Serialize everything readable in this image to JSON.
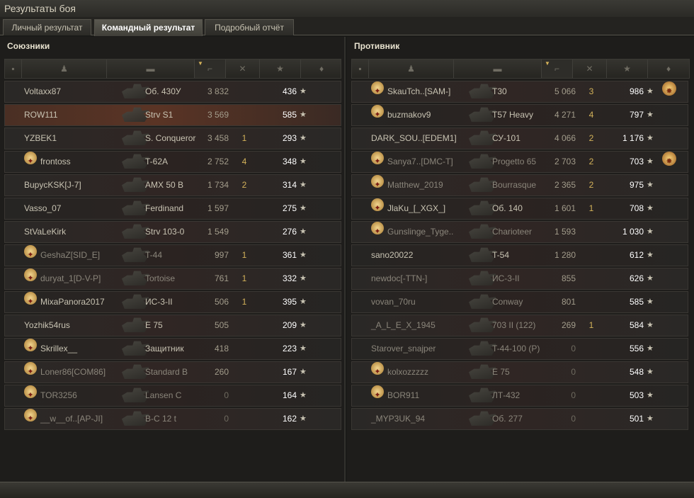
{
  "window": {
    "title": "Результаты боя"
  },
  "tabs": [
    {
      "label": "Личный результат",
      "active": false
    },
    {
      "label": "Командный результат",
      "active": true
    },
    {
      "label": "Подробный отчёт",
      "active": false
    }
  ],
  "columns": {
    "icons": [
      "badge-icon",
      "player-icon",
      "tank-icon",
      "damage-icon",
      "kills-icon",
      "xp-star-icon",
      "medal-icon"
    ]
  },
  "allies": {
    "title": "Союзники",
    "rows": [
      {
        "player": "Voltaxx87",
        "tank": "Об. 430У",
        "damage": "3 832",
        "kills": "",
        "xp": "436",
        "badge": false,
        "medal": false,
        "state": "alive"
      },
      {
        "player": "ROW111",
        "tank": "Strv S1",
        "damage": "3 569",
        "kills": "",
        "xp": "585",
        "badge": false,
        "medal": false,
        "state": "self"
      },
      {
        "player": "YZBEK1",
        "tank": "S. Conqueror",
        "damage": "3 458",
        "kills": "1",
        "xp": "293",
        "badge": false,
        "medal": false,
        "state": "alive"
      },
      {
        "player": "frontoss",
        "tank": "T-62A",
        "damage": "2 752",
        "kills": "4",
        "xp": "348",
        "badge": true,
        "medal": false,
        "state": "alive"
      },
      {
        "player": "BupycKSK[J-7]",
        "tank": "AMX 50 B",
        "damage": "1 734",
        "kills": "2",
        "xp": "314",
        "badge": false,
        "medal": false,
        "state": "alive"
      },
      {
        "player": "Vasso_07",
        "tank": "Ferdinand",
        "damage": "1 597",
        "kills": "",
        "xp": "275",
        "badge": false,
        "medal": false,
        "state": "alive"
      },
      {
        "player": "StVaLeKirk",
        "tank": "Strv 103-0",
        "damage": "1 549",
        "kills": "",
        "xp": "276",
        "badge": false,
        "medal": false,
        "state": "alive"
      },
      {
        "player": "GeshaZ[SID_E]",
        "tank": "T-44",
        "damage": "997",
        "kills": "1",
        "xp": "361",
        "badge": true,
        "medal": false,
        "state": "dead"
      },
      {
        "player": "duryat_1[D-V-P]",
        "tank": "Tortoise",
        "damage": "761",
        "kills": "1",
        "xp": "332",
        "badge": true,
        "medal": false,
        "state": "dead"
      },
      {
        "player": "MixaPanora2017",
        "tank": "ИС-3-II",
        "damage": "506",
        "kills": "1",
        "xp": "395",
        "badge": true,
        "medal": false,
        "state": "alive"
      },
      {
        "player": "Yozhik54rus",
        "tank": "E 75",
        "damage": "505",
        "kills": "",
        "xp": "209",
        "badge": false,
        "medal": false,
        "state": "alive"
      },
      {
        "player": "Skrillex__",
        "tank": "Защитник",
        "damage": "418",
        "kills": "",
        "xp": "223",
        "badge": true,
        "medal": false,
        "state": "alive"
      },
      {
        "player": "Loner86[COM86]",
        "tank": "Standard B",
        "damage": "260",
        "kills": "",
        "xp": "167",
        "badge": true,
        "medal": false,
        "state": "dead"
      },
      {
        "player": "TOR3256",
        "tank": "Lansen C",
        "damage": "0",
        "kills": "",
        "xp": "164",
        "badge": true,
        "medal": false,
        "state": "dead"
      },
      {
        "player": "__w__of..[AP-JI]",
        "tank": "B-C 12 t",
        "damage": "0",
        "kills": "",
        "xp": "162",
        "badge": true,
        "medal": false,
        "state": "dead"
      }
    ]
  },
  "enemies": {
    "title": "Противник",
    "rows": [
      {
        "player": "SkauTch..[SAM-]",
        "tank": "T30",
        "damage": "5 066",
        "kills": "3",
        "xp": "986",
        "badge": true,
        "medal": true,
        "state": "alive"
      },
      {
        "player": "buzmakov9",
        "tank": "T57 Heavy",
        "damage": "4 271",
        "kills": "4",
        "xp": "797",
        "badge": true,
        "medal": false,
        "state": "alive"
      },
      {
        "player": "DARK_SOU..[EDEM1]",
        "tank": "СУ-101",
        "damage": "4 066",
        "kills": "2",
        "xp": "1 176",
        "badge": false,
        "medal": false,
        "state": "alive"
      },
      {
        "player": "Sanya7..[DMC-T]",
        "tank": "Progetto 65",
        "damage": "2 703",
        "kills": "2",
        "xp": "703",
        "badge": true,
        "medal": true,
        "state": "dead"
      },
      {
        "player": "Matthew_2019",
        "tank": "Bourrasque",
        "damage": "2 365",
        "kills": "2",
        "xp": "975",
        "badge": true,
        "medal": false,
        "state": "dead"
      },
      {
        "player": "JlaKu_[_XGX_]",
        "tank": "Об. 140",
        "damage": "1 601",
        "kills": "1",
        "xp": "708",
        "badge": true,
        "medal": false,
        "state": "alive"
      },
      {
        "player": "Gunslinge_Tyge..",
        "tank": "Charioteer",
        "damage": "1 593",
        "kills": "",
        "xp": "1 030",
        "badge": true,
        "medal": false,
        "state": "dead"
      },
      {
        "player": "sano20022",
        "tank": "T-54",
        "damage": "1 280",
        "kills": "",
        "xp": "612",
        "badge": false,
        "medal": false,
        "state": "alive"
      },
      {
        "player": "newdoc[-TTN-]",
        "tank": "ИС-3-II",
        "damage": "855",
        "kills": "",
        "xp": "626",
        "badge": false,
        "medal": false,
        "state": "dead"
      },
      {
        "player": "vovan_70ru",
        "tank": "Conway",
        "damage": "801",
        "kills": "",
        "xp": "585",
        "badge": false,
        "medal": false,
        "state": "dead"
      },
      {
        "player": "_A_L_E_X_1945",
        "tank": "703 II (122)",
        "damage": "269",
        "kills": "1",
        "xp": "584",
        "badge": false,
        "medal": false,
        "state": "dead"
      },
      {
        "player": "Starover_snajper",
        "tank": "T-44-100 (P)",
        "damage": "0",
        "kills": "",
        "xp": "556",
        "badge": false,
        "medal": false,
        "state": "dead"
      },
      {
        "player": "kolxozzzzz",
        "tank": "E 75",
        "damage": "0",
        "kills": "",
        "xp": "548",
        "badge": true,
        "medal": false,
        "state": "dead"
      },
      {
        "player": "BOR911",
        "tank": "ЛТ-432",
        "damage": "0",
        "kills": "",
        "xp": "503",
        "badge": true,
        "medal": false,
        "state": "dead"
      },
      {
        "player": "_MYP3UK_94",
        "tank": "Об. 277",
        "damage": "0",
        "kills": "",
        "xp": "501",
        "badge": false,
        "medal": false,
        "state": "dead"
      }
    ]
  }
}
